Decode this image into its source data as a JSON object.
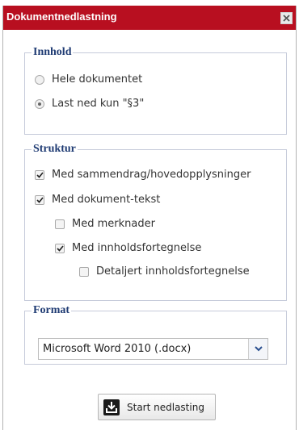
{
  "dialog": {
    "title": "Dokumentnedlastning",
    "close_icon": "close-icon"
  },
  "content_group": {
    "legend": "Innhold",
    "options": [
      {
        "label": "Hele dokumentet",
        "selected": false
      },
      {
        "label": "Last ned kun \"§3\"",
        "selected": true
      }
    ]
  },
  "structure_group": {
    "legend": "Struktur",
    "options": [
      {
        "label": "Med sammendrag/hovedopplysninger",
        "checked": true
      },
      {
        "label": "Med dokument-tekst",
        "checked": true
      },
      {
        "label": "Med merknader",
        "checked": false
      },
      {
        "label": "Med innholdsfortegnelse",
        "checked": true
      },
      {
        "label": "Detaljert innholdsfortegnelse",
        "checked": false
      }
    ]
  },
  "format_group": {
    "legend": "Format",
    "selected": "Microsoft Word 2010 (.docx)",
    "dropdown_icon": "chevron-down-icon"
  },
  "actions": {
    "start_label": "Start nedlasting",
    "start_icon": "download-icon"
  },
  "colors": {
    "titlebar": "#b80f20",
    "legend": "#1f3b73",
    "group_border": "#c6cbda"
  }
}
